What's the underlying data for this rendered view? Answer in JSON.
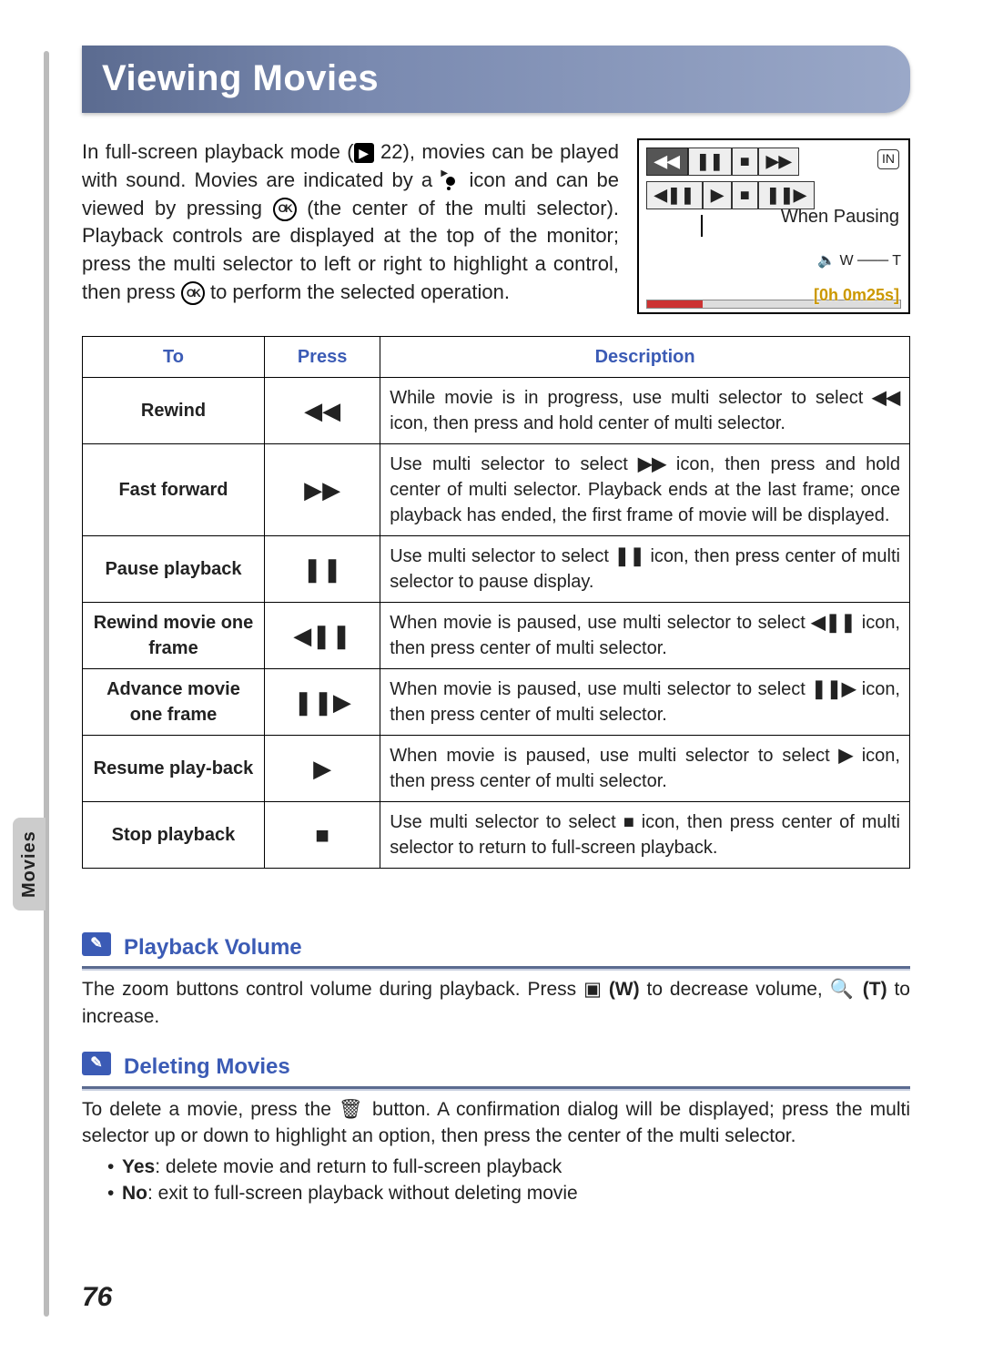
{
  "title": "Viewing Movies",
  "side_tab": "Movies",
  "page_number": "76",
  "intro": {
    "p1a": "In full-screen playback mode (",
    "p1_play_icon": "▶",
    "p1_ref": " 22), movies can be played with sound. Movies are indicated by a ",
    "p1_movie_icon": "movie-icon",
    "p1b": " icon and can be viewed by pressing ",
    "ok": "OK",
    "p1c": " (the center of the multi selector). Playback controls are displayed at the top of the monitor; press the multi selector to left or right to highlight a control, then press ",
    "p1d": " to perform the selected operation."
  },
  "illus": {
    "top_row": [
      "◀◀",
      "❚❚",
      "■",
      "▶▶"
    ],
    "second_row": [
      "◀❚❚",
      "▶",
      "■",
      "❚❚▶"
    ],
    "pausing_label": "When Pausing",
    "vol_row": "🔈 W ─── T",
    "in_badge": "IN",
    "time": "[0h 0m25s]"
  },
  "table": {
    "headers": [
      "To",
      "Press",
      "Description"
    ],
    "rows": [
      {
        "to": "Rewind",
        "press": "◀◀",
        "desc_a": "While movie is in progress, use multi selector to select ",
        "desc_icon": "◀◀",
        "desc_b": " icon, then press and hold center of multi selector."
      },
      {
        "to": "Fast forward",
        "press": "▶▶",
        "desc_a": "Use multi selector to select ",
        "desc_icon": "▶▶",
        "desc_b": " icon, then press and hold center of multi selector. Playback ends at the last frame; once playback has ended, the first frame of movie will be displayed."
      },
      {
        "to": "Pause playback",
        "press": "❚❚",
        "desc_a": "Use multi selector to select ",
        "desc_icon": "❚❚",
        "desc_b": " icon, then press center of multi selector to pause display."
      },
      {
        "to": "Rewind movie one frame",
        "press": "◀❚❚",
        "desc_a": "When movie is paused, use multi selector to select ",
        "desc_icon": "◀❚❚",
        "desc_b": " icon, then press center of multi selector."
      },
      {
        "to": "Advance movie one frame",
        "press": "❚❚▶",
        "desc_a": "When movie is paused, use multi selector to select ",
        "desc_icon": "❚❚▶",
        "desc_b": " icon, then press center of multi selector."
      },
      {
        "to": "Resume play-back",
        "press": "▶",
        "desc_a": "When movie is paused, use multi selector to select ",
        "desc_icon": "▶",
        "desc_b": " icon, then press center of multi selector."
      },
      {
        "to": "Stop playback",
        "press": "■",
        "desc_a": "Use multi selector to select ",
        "desc_icon": "■",
        "desc_b": " icon, then press center of multi selector to return to full-screen playback."
      }
    ]
  },
  "notes": [
    {
      "heading": "Playback Volume",
      "body_a": "The zoom buttons control volume during playback. Press ",
      "icon1": "▣",
      "w": " (W)",
      "body_b": " to decrease volume, ",
      "icon2": "🔍",
      "t": " (T)",
      "body_c": " to increase."
    },
    {
      "heading": "Deleting Movies",
      "body_a": "To delete a movie, press the ",
      "icon1": "🗑",
      "body_b": " button. A confirmation dialog will be displayed; press the multi selector up or down to highlight an option, then press the center of the multi selector.",
      "bullets": [
        {
          "k": "Yes",
          "v": ": delete movie and return to full-screen playback"
        },
        {
          "k": "No",
          "v": ": exit to full-screen playback without deleting movie"
        }
      ]
    }
  ]
}
